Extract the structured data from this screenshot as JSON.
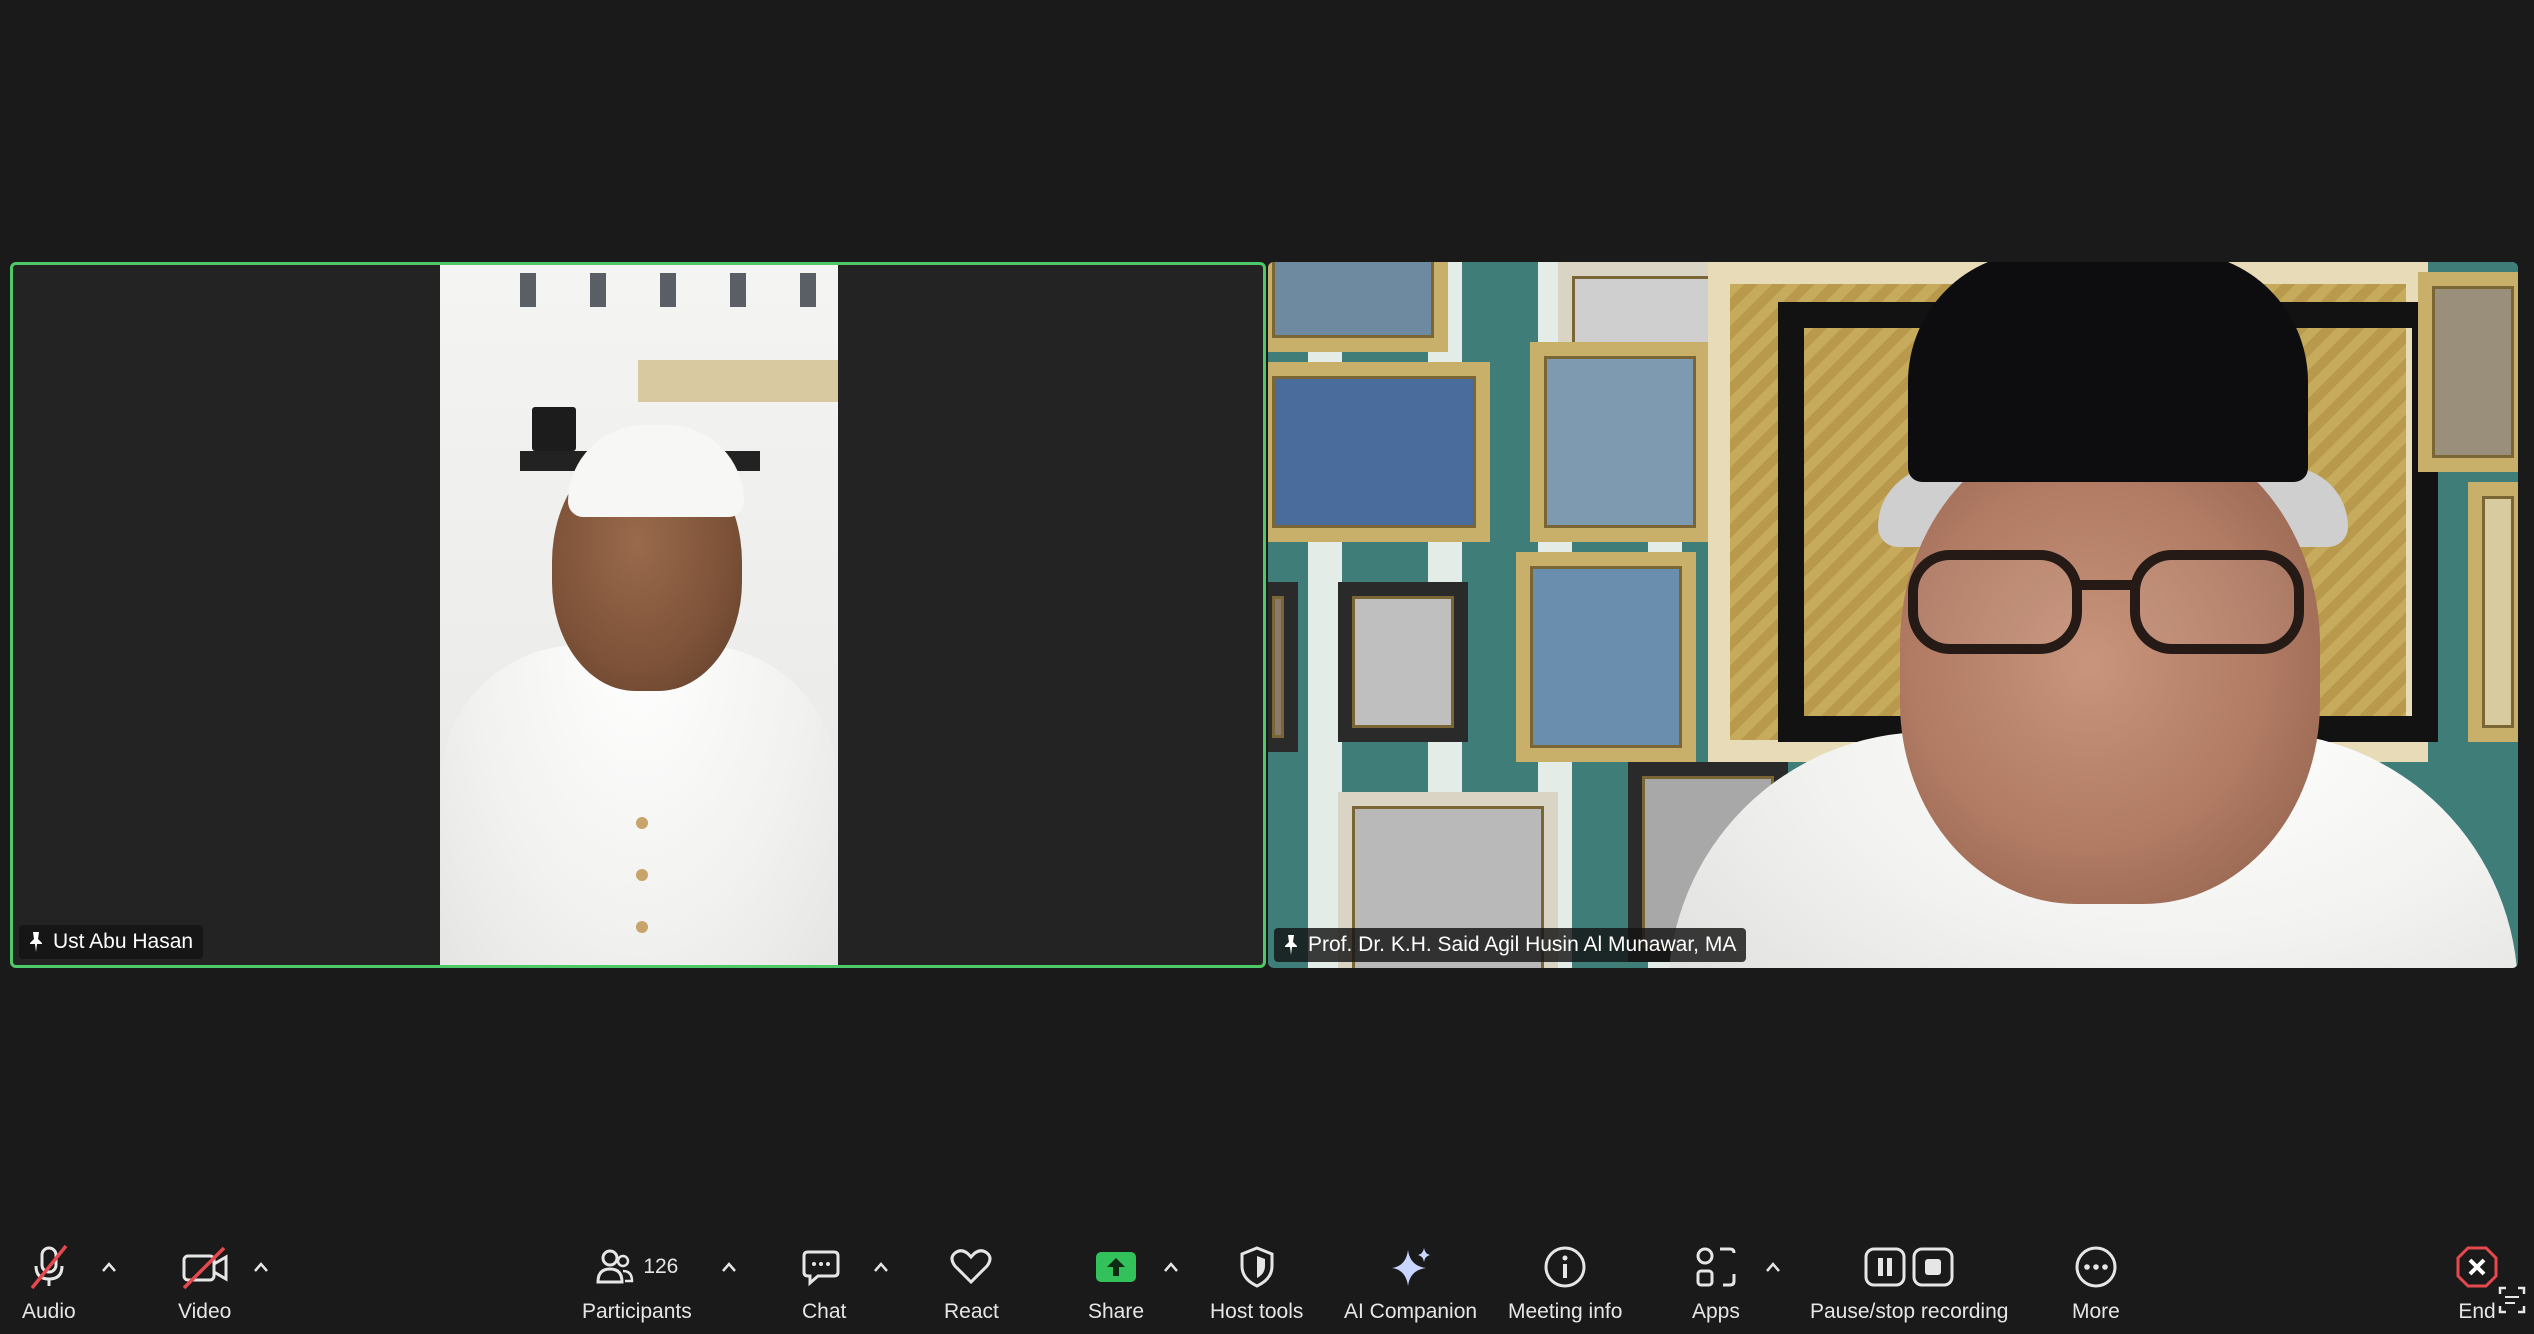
{
  "participants": [
    {
      "name": "Ust Abu Hasan",
      "active_speaker": true
    },
    {
      "name": "Prof. Dr. K.H. Said Agil Husin Al Munawar, MA",
      "active_speaker": false
    }
  ],
  "toolbar": {
    "audio_label": "Audio",
    "video_label": "Video",
    "participants_label": "Participants",
    "participants_count": "126",
    "chat_label": "Chat",
    "react_label": "React",
    "share_label": "Share",
    "host_tools_label": "Host tools",
    "ai_companion_label": "AI Companion",
    "meeting_info_label": "Meeting info",
    "apps_label": "Apps",
    "recording_label": "Pause/stop recording",
    "more_label": "More",
    "end_label": "End"
  },
  "colors": {
    "active_speaker_border": "#4ec96a",
    "share_green": "#33c15b",
    "end_red": "#e5484d",
    "muted_red": "#e5484d"
  },
  "icons": {
    "audio": "microphone-muted-icon",
    "video": "camera-off-icon",
    "participants": "people-icon",
    "chat": "chat-bubbles-icon",
    "react": "heart-icon",
    "share": "share-screen-icon",
    "host_tools": "shield-icon",
    "ai_companion": "sparkle-icon",
    "meeting_info": "info-icon",
    "apps": "apps-grid-icon",
    "recording": "pause-stop-icon",
    "more": "more-dots-icon",
    "end": "end-call-icon"
  }
}
